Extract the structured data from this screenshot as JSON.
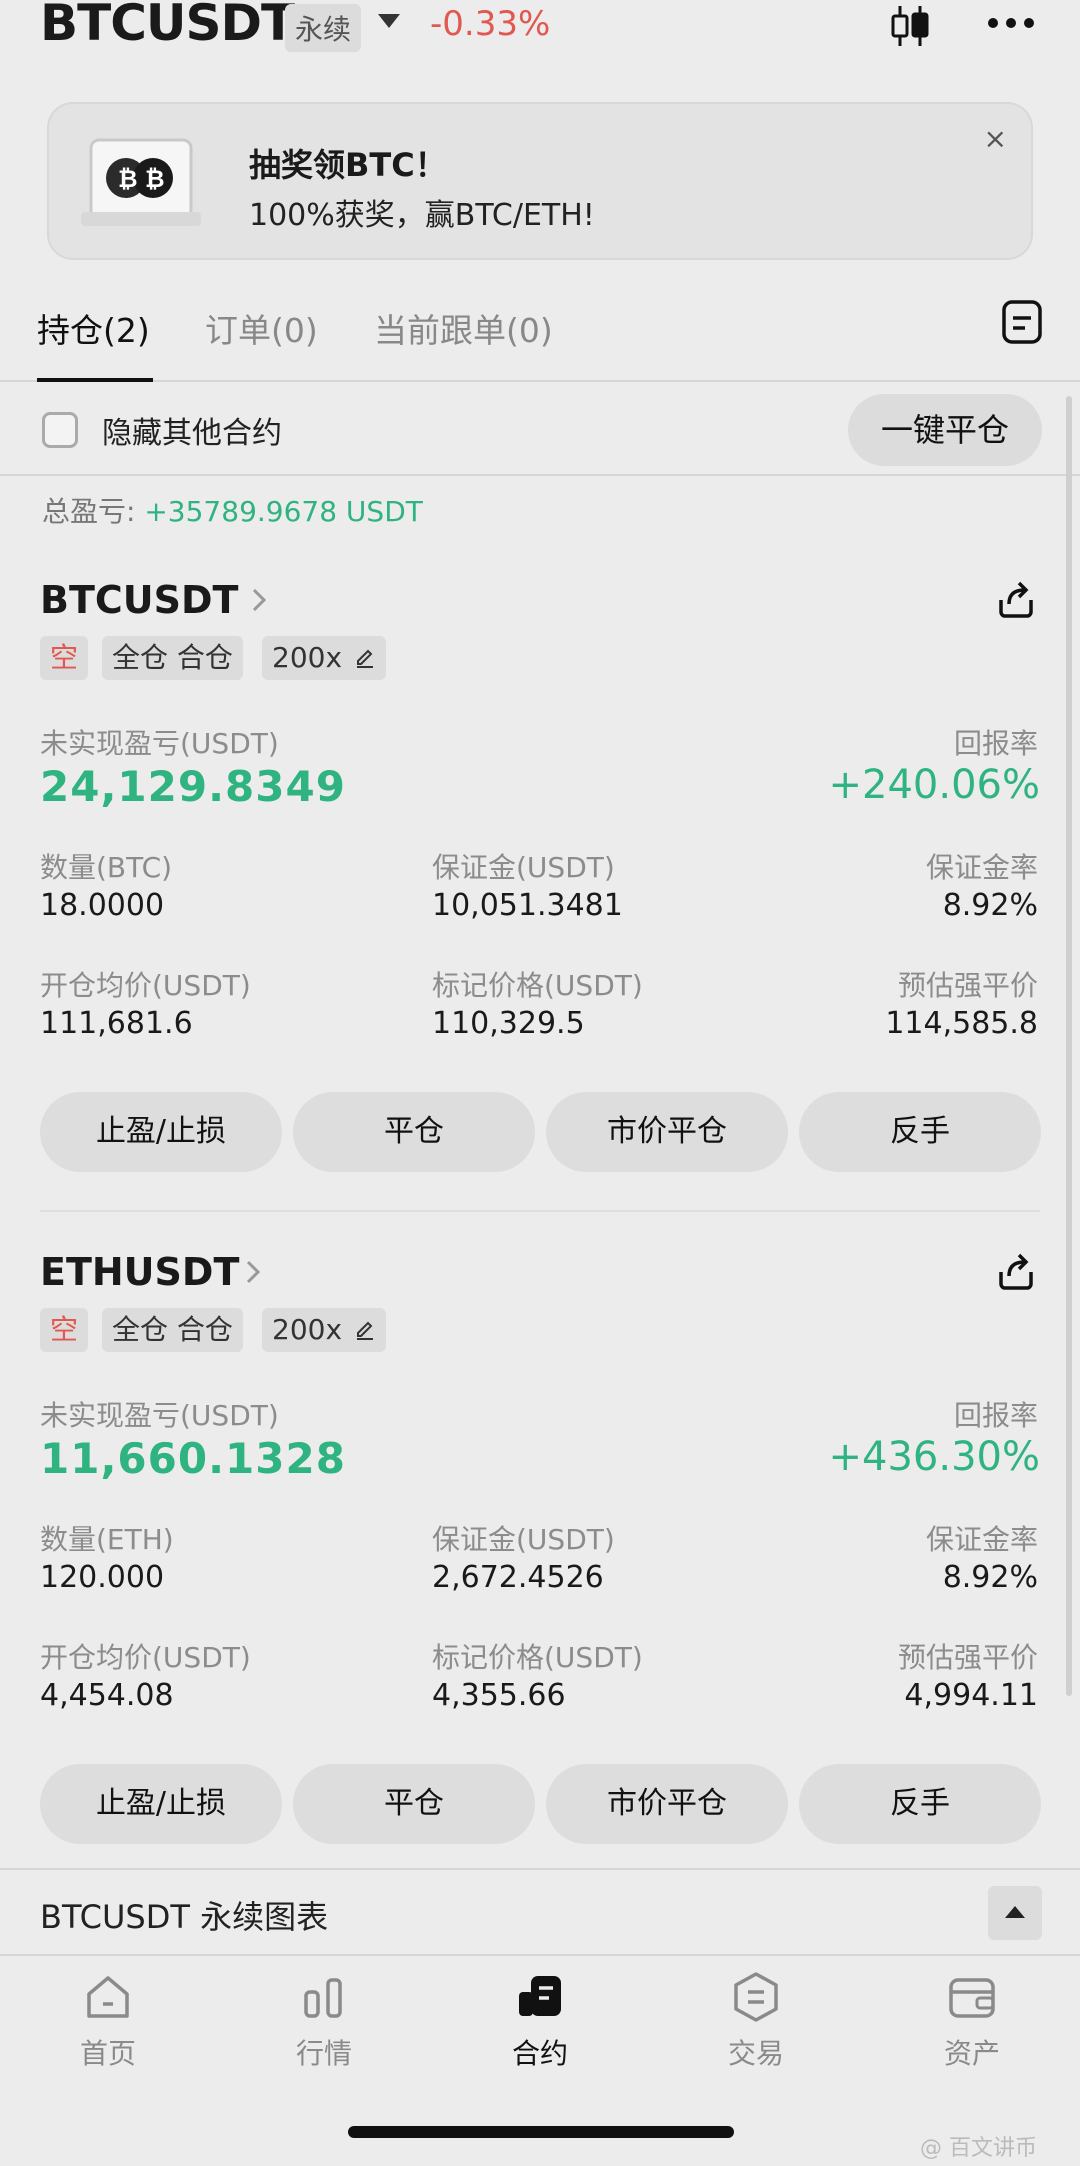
{
  "header": {
    "symbol": "BTCUSDT",
    "contract_type": "永续",
    "change": "-0.33%",
    "icons": [
      "candlestick-icon",
      "more-icon"
    ]
  },
  "banner": {
    "title": "抽奖领BTC！",
    "subtitle": "100%获奖，赢BTC/ETH!",
    "close": "×"
  },
  "tabs": [
    {
      "label": "持仓(2)",
      "active": true
    },
    {
      "label": "订单(0)",
      "active": false
    },
    {
      "label": "当前跟单(0)",
      "active": false
    }
  ],
  "controls": {
    "hide_label": "隐藏其他合约",
    "close_all": "一键平仓"
  },
  "summary": {
    "total_label": "总盈亏: ",
    "total_value": "+35789.9678 USDT"
  },
  "positions": [
    {
      "symbol": "BTCUSDT",
      "side": "空",
      "margin_mode": "全仓 合仓",
      "leverage": "200x",
      "pnl_label": "未实现盈亏(USDT)",
      "pnl": "24,129.8349",
      "roe_label": "回报率",
      "roe": "+240.06%",
      "qty_label": "数量(BTC)",
      "qty": "18.0000",
      "margin_label": "保证金(USDT)",
      "margin": "10,051.3481",
      "margin_ratio_label": "保证金率",
      "margin_ratio": "8.92%",
      "entry_label": "开仓均价(USDT)",
      "entry": "111,681.6",
      "mark_label": "标记价格(USDT)",
      "mark": "110,329.5",
      "liq_label": "预估强平价",
      "liq": "114,585.8",
      "buttons": [
        "止盈/止损",
        "平仓",
        "市价平仓",
        "反手"
      ]
    },
    {
      "symbol": "ETHUSDT",
      "side": "空",
      "margin_mode": "全仓 合仓",
      "leverage": "200x",
      "pnl_label": "未实现盈亏(USDT)",
      "pnl": "11,660.1328",
      "roe_label": "回报率",
      "roe": "+436.30%",
      "qty_label": "数量(ETH)",
      "qty": "120.000",
      "margin_label": "保证金(USDT)",
      "margin": "2,672.4526",
      "margin_ratio_label": "保证金率",
      "margin_ratio": "8.92%",
      "entry_label": "开仓均价(USDT)",
      "entry": "4,454.08",
      "mark_label": "标记价格(USDT)",
      "mark": "4,355.66",
      "liq_label": "预估强平价",
      "liq": "4,994.11",
      "buttons": [
        "止盈/止损",
        "平仓",
        "市价平仓",
        "反手"
      ]
    }
  ],
  "chart_section": {
    "label": "BTCUSDT 永续图表"
  },
  "bottom_nav": [
    {
      "label": "首页",
      "icon": "home-icon",
      "active": false
    },
    {
      "label": "行情",
      "icon": "market-icon",
      "active": false
    },
    {
      "label": "合约",
      "icon": "futures-icon",
      "active": true
    },
    {
      "label": "交易",
      "icon": "trade-icon",
      "active": false
    },
    {
      "label": "资产",
      "icon": "wallet-icon",
      "active": false
    }
  ],
  "watermark": "@ 百文讲币",
  "colors": {
    "profit_green": "#2fb380",
    "loss_red": "#e0584f",
    "background": "#ececec"
  }
}
